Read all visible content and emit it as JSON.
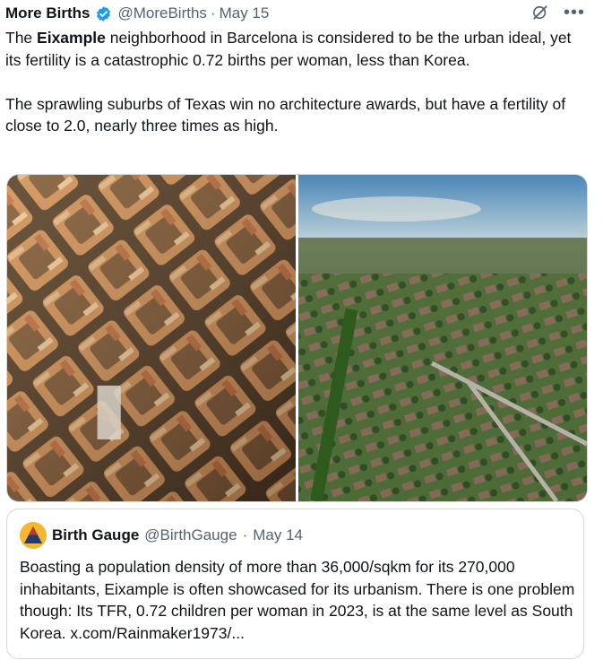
{
  "tweet": {
    "author_name": "More Births",
    "author_handle": "@MoreBirths",
    "separator": "·",
    "date": "May 15",
    "text_p1_before": "The ",
    "text_p1_bold": "Eixample",
    "text_p1_after": " neighborhood in Barcelona is considered to be the urban ideal, yet its fertility is a catastrophic 0.72 births per woman, less than Korea.",
    "text_p2": "The sprawling suburbs of Texas win no architecture awards, but have a fertility of close to 2.0, nearly three times as high.",
    "more_glyph": "•••",
    "icons": {
      "verified": "verified-badge-icon",
      "grok": "grok-icon",
      "more": "more-options-icon"
    },
    "colors": {
      "verified": "#1d9bf0",
      "muted": "#536471",
      "border": "#cfd9de"
    }
  },
  "quote": {
    "author_name": "Birth Gauge",
    "author_handle": "@BirthGauge",
    "separator": "·",
    "date": "May 14",
    "text": "Boasting a population density of more than 36,000/sqkm for its 270,000 inhabitants, Eixample is often showcased for its urbanism. There is one problem though: Its TFR, 0.72 children per woman in 2023, is at the same level as South Korea. x.com/Rainmaker1973/..."
  }
}
